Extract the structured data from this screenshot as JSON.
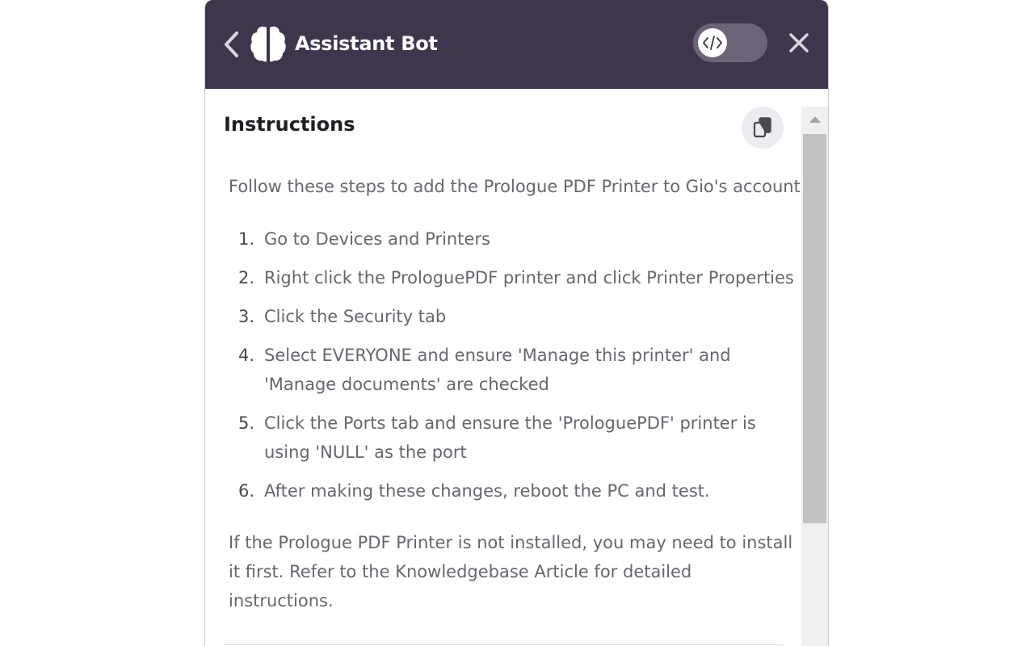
{
  "header": {
    "title": "Assistant Bot",
    "back_icon": "chevron-left-icon",
    "logo_icon": "brain-icon",
    "toggle_icon": "code-icon",
    "close_icon": "close-icon",
    "background_color": "#3f364d"
  },
  "content": {
    "section_title": "Instructions",
    "copy_icon": "copy-icon",
    "intro": "Follow these steps to add the Prologue PDF Printer to Gio's account:",
    "steps": [
      {
        "number": "1.",
        "text": "Go to Devices and Printers"
      },
      {
        "number": "2.",
        "text": "Right click the ProloguePDF printer and click Printer Properties"
      },
      {
        "number": "3.",
        "text": "Click the Security tab"
      },
      {
        "number": "4.",
        "text": "Select EVERYONE and ensure 'Manage this printer' and 'Manage documents' are checked"
      },
      {
        "number": "5.",
        "text": "Click the Ports tab and ensure the 'ProloguePDF' printer is using 'NULL' as the port"
      },
      {
        "number": "6.",
        "text": "After making these changes, reboot the PC and test."
      }
    ],
    "outro": "If the Prologue PDF Printer is not installed, you may need to install it first. Refer to the Knowledgebase Article for detailed instructions."
  },
  "scrollbar": {
    "up_icon": "scroll-up-arrow-icon"
  }
}
